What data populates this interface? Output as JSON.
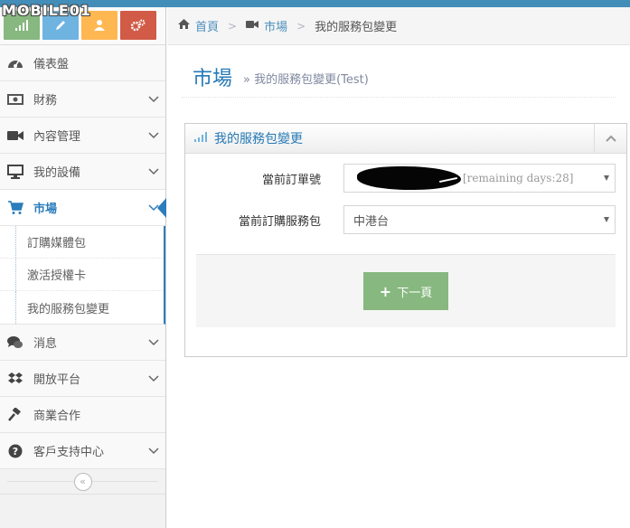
{
  "watermark": "MOBILE01",
  "colors": {
    "accent": "#2679b5",
    "topbar": "#438eb9",
    "green": "#87b87f",
    "blue": "#6fb3e0",
    "orange": "#ffb752",
    "red": "#d15b47"
  },
  "shortcuts": [
    {
      "icon": "signal-icon"
    },
    {
      "icon": "pencil-icon"
    },
    {
      "icon": "users-icon"
    },
    {
      "icon": "cogs-icon"
    }
  ],
  "sidebar": {
    "items": [
      {
        "label": "儀表盤",
        "icon": "dashboard-icon"
      },
      {
        "label": "財務",
        "icon": "money-icon"
      },
      {
        "label": "內容管理",
        "icon": "video-camera-icon"
      },
      {
        "label": "我的設備",
        "icon": "desktop-icon"
      },
      {
        "label": "市場",
        "icon": "shopping-cart-icon"
      },
      {
        "label": "消息",
        "icon": "comments-icon"
      },
      {
        "label": "開放平台",
        "icon": "dropbox-icon"
      },
      {
        "label": "商業合作",
        "icon": "gavel-icon"
      },
      {
        "label": "客戶支持中心",
        "icon": "question-circle-icon"
      }
    ],
    "submenu": [
      "訂購媒體包",
      "激活授權卡",
      "我的服務包變更"
    ],
    "collapse_glyph": "«"
  },
  "breadcrumbs": {
    "home": "首頁",
    "market": "市場",
    "current": "我的服務包變更"
  },
  "page_header": {
    "title": "市場",
    "subtitle": "我的服務包變更(Test)"
  },
  "widget": {
    "title": "我的服務包變更",
    "form": {
      "order_label": "當前訂單號",
      "order_suffix": "[remaining days:28]",
      "package_label": "當前訂購服務包",
      "package_value": "中港台"
    },
    "next_button": "下一頁"
  }
}
